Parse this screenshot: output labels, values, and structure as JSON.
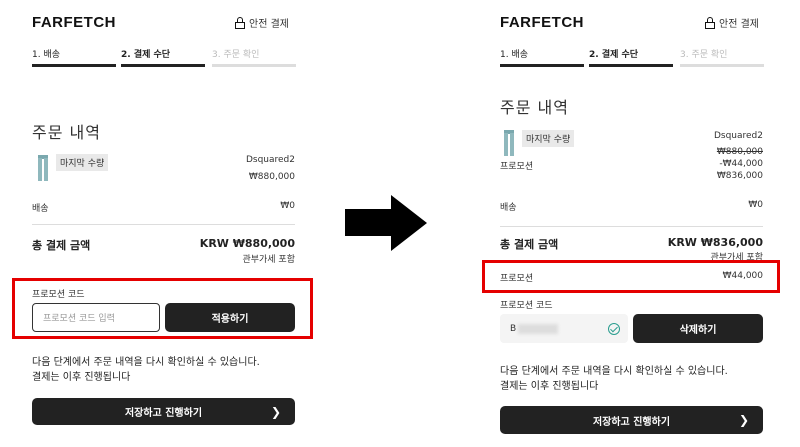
{
  "left": {
    "logo": "FARFETCH",
    "secure": "안전 결제",
    "steps": [
      "1. 배송",
      "2. 결제 수단",
      "3. 주문 확인"
    ],
    "section_title": "주문 내역",
    "item": {
      "chip": "마지막 수량",
      "brand": "Dsquared2",
      "price": "₩880,000"
    },
    "shipping": {
      "label": "배송",
      "value": "₩0"
    },
    "total": {
      "label": "총 결제 금액",
      "value": "KRW ₩880,000",
      "note": "관부가세 포함"
    },
    "promo": {
      "label": "프로모션 코드",
      "placeholder": "프로모션 코드 입력",
      "apply": "적용하기"
    },
    "notice_1": "다음 단계에서 주문 내역을 다시 확인하실 수 있습니다.",
    "notice_2": "결제는 이후 진행됩니다",
    "cta": "저장하고 진행하기"
  },
  "right": {
    "logo": "FARFETCH",
    "secure": "안전 결제",
    "steps": [
      "1. 배송",
      "2. 결제 수단",
      "3. 주문 확인"
    ],
    "section_title": "주문 내역",
    "item": {
      "chip": "마지막 수량",
      "brand": "Dsquared2",
      "promo_label": "프로모션",
      "orig_price": "₩880,000",
      "discount": "-₩44,000",
      "final_price": "₩836,000"
    },
    "shipping": {
      "label": "배송",
      "value": "₩0"
    },
    "total": {
      "label": "총 결제 금액",
      "value": "KRW ₩836,000",
      "note": "관부가세 포함"
    },
    "promo_line": {
      "label": "프로모션",
      "value": "₩44,000"
    },
    "promo": {
      "label": "프로모션 코드",
      "code_prefix": "B",
      "delete": "삭제하기"
    },
    "notice_1": "다음 단계에서 주문 내역을 다시 확인하실 수 있습니다.",
    "notice_2": "결제는 이후 진행됩니다",
    "cta": "저장하고 진행하기"
  },
  "colors": {
    "highlight": "#e50000",
    "dark": "#222222",
    "valid": "#2a9d8f"
  },
  "icons": [
    "lock-icon",
    "chevron-right-icon",
    "check-circle-icon",
    "arrow-right-icon",
    "product-thumbnail"
  ]
}
